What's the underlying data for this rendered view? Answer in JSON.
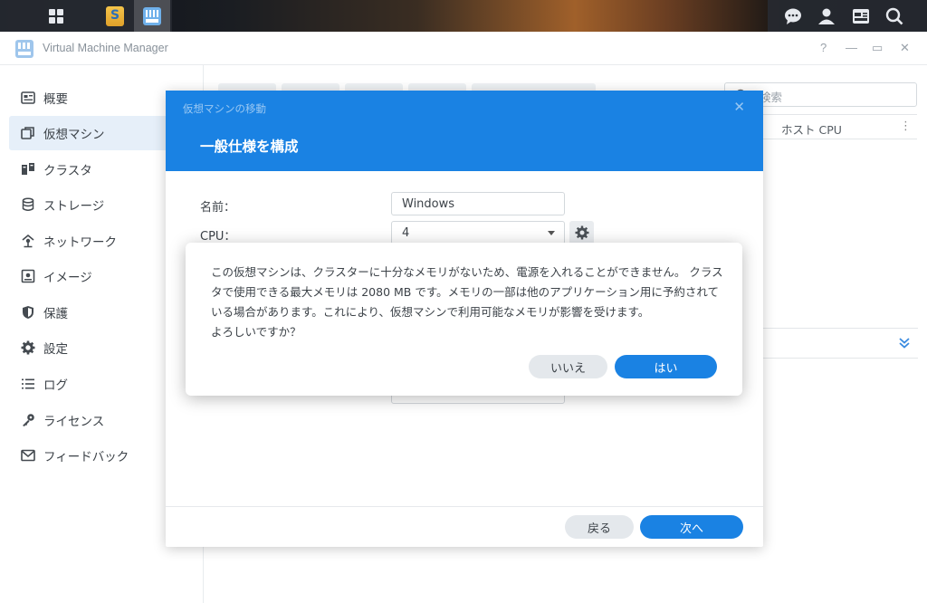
{
  "window": {
    "title": "Virtual Machine Manager",
    "help": "?",
    "minimize": "—",
    "restore": "▭",
    "close": "✕"
  },
  "sidebar": {
    "items": [
      {
        "label": "概要",
        "icon": "overview-icon",
        "active": false
      },
      {
        "label": "仮想マシン",
        "icon": "virtual-machine-icon",
        "active": true
      },
      {
        "label": "クラスタ",
        "icon": "cluster-icon",
        "active": false
      },
      {
        "label": "ストレージ",
        "icon": "storage-icon",
        "active": false
      },
      {
        "label": "ネットワーク",
        "icon": "network-icon",
        "active": false
      },
      {
        "label": "イメージ",
        "icon": "image-icon",
        "active": false
      },
      {
        "label": "保護",
        "icon": "protection-icon",
        "active": false
      },
      {
        "label": "設定",
        "icon": "settings-icon",
        "active": false
      },
      {
        "label": "ログ",
        "icon": "log-icon",
        "active": false
      },
      {
        "label": "ライセンス",
        "icon": "license-icon",
        "active": false
      },
      {
        "label": "フィードバック",
        "icon": "feedback-icon",
        "active": false
      }
    ]
  },
  "main": {
    "search_placeholder": "検索",
    "column_header": "ホスト CPU"
  },
  "wizard": {
    "subtitle": "仮想マシンの移動",
    "heading": "一般仕様を構成",
    "name_label": "名前：",
    "name_value": "Windows",
    "cpu_label": "CPU：",
    "cpu_value": "4",
    "back_label": "戻る",
    "next_label": "次へ"
  },
  "confirm": {
    "message": "この仮想マシンは、クラスターに十分なメモリがないため、電源を入れることができません。 クラスタで使用できる最大メモリは 2080 MB です。メモリの一部は他のアプリケーション用に予約されている場合があります。これにより、仮想マシンで利用可能なメモリが影響を受けます。\nよろしいですか？",
    "no_label": "いいえ",
    "yes_label": "はい"
  },
  "colors": {
    "accent": "#1a82e3",
    "sidebar_active": "#e6eff9"
  }
}
